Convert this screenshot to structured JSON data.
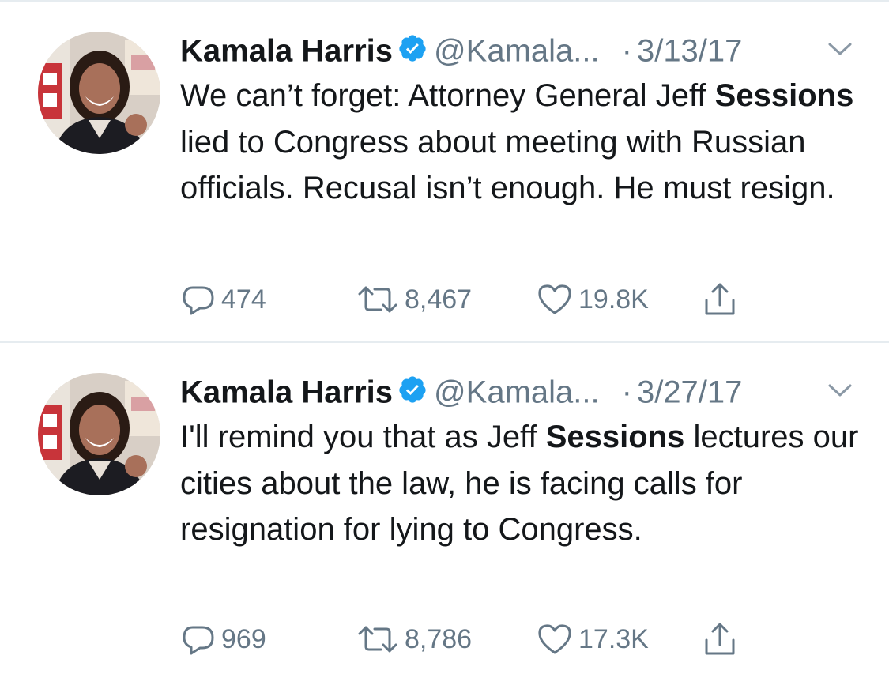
{
  "colors": {
    "text_primary": "#14171a",
    "text_secondary": "#657786",
    "verified_blue": "#1da1f2",
    "divider": "#e6ecf0"
  },
  "icons": {
    "verified": "verified-badge-icon",
    "caret": "chevron-down-icon",
    "reply": "reply-icon",
    "retweet": "retweet-icon",
    "like": "heart-icon",
    "share": "share-icon"
  },
  "tweets": [
    {
      "author": {
        "name": "Kamala Harris",
        "handle": "@Kamala..."
      },
      "separator": "·",
      "date": "3/13/17",
      "text": {
        "part1": "We can’t forget: Attorney General Jeff ",
        "highlight": "Sessions",
        "part2": " lied to Congress about meeting with Russian officials. Recusal isn’t enough. He must resign."
      },
      "stats": {
        "replies": "474",
        "retweets": "8,467",
        "likes": "19.8K"
      }
    },
    {
      "author": {
        "name": "Kamala Harris",
        "handle": "@Kamala..."
      },
      "separator": "·",
      "date": "3/27/17",
      "text": {
        "part1": "I'll remind you that as Jeff ",
        "highlight": "Sessions",
        "part2": " lectures our cities about the law, he is facing calls for resignation for lying to Congress."
      },
      "stats": {
        "replies": "969",
        "retweets": "8,786",
        "likes": "17.3K"
      }
    }
  ]
}
